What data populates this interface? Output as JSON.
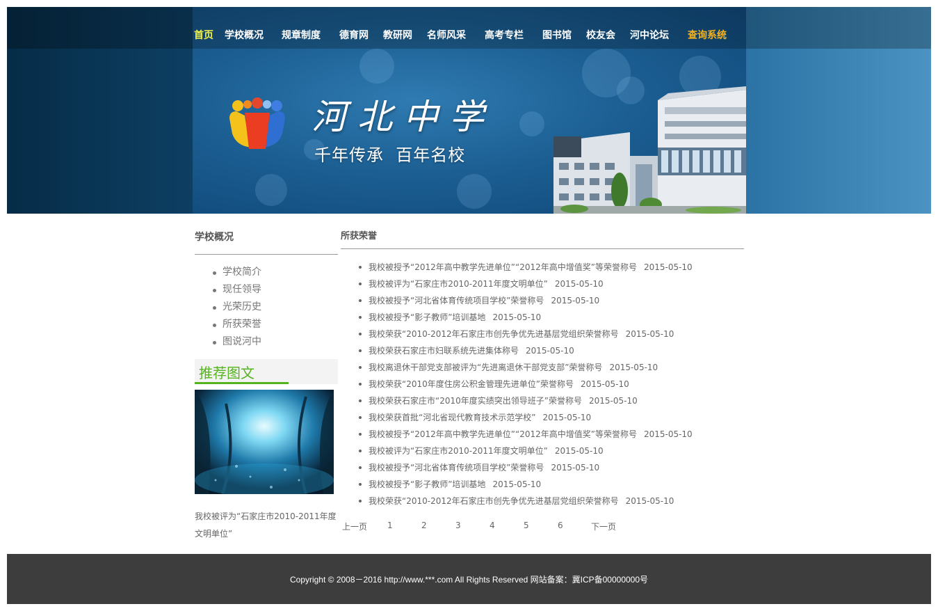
{
  "nav": {
    "items": [
      "首页",
      "学校概况",
      "规章制度",
      "德育网",
      "教研网",
      "名师风采",
      "高考专栏",
      "图书馆",
      "校友会",
      "河中论坛",
      "查询系统"
    ]
  },
  "banner": {
    "school_name": "河北中学",
    "slogan": "千年传承  百年名校"
  },
  "sidebar": {
    "title": "学校概况",
    "items": [
      "学校简介",
      "现任领导",
      "光荣历史",
      "所获荣誉",
      "图说河中"
    ],
    "recommend_title": "推荐图文",
    "recommend_caption": "我校被评为“石家庄市2010-2011年度文明单位”"
  },
  "main": {
    "title": "所获荣誉",
    "news": [
      {
        "title": "我校被授予“2012年高中教学先进单位”“2012年高中增值奖”等荣誉称号",
        "date": "2015-05-10"
      },
      {
        "title": "我校被评为“石家庄市2010-2011年度文明单位”",
        "date": "2015-05-10"
      },
      {
        "title": "我校被授予“河北省体育传统项目学校”荣誉称号",
        "date": "2015-05-10"
      },
      {
        "title": "我校被授予“影子教师”培训基地",
        "date": "2015-05-10"
      },
      {
        "title": "我校荣获“2010-2012年石家庄市创先争优先进基层党组织荣誉称号",
        "date": "2015-05-10"
      },
      {
        "title": "我校荣获石家庄市妇联系统先进集体称号",
        "date": "2015-05-10"
      },
      {
        "title": "我校离退休干部党支部被评为“先进离退休干部党支部”荣誉称号",
        "date": "2015-05-10"
      },
      {
        "title": "我校荣获“2010年度住房公积金管理先进单位”荣誉称号",
        "date": "2015-05-10"
      },
      {
        "title": "我校荣获石家庄市“2010年度实绩突出领导班子”荣誉称号",
        "date": "2015-05-10"
      },
      {
        "title": "我校荣获首批“河北省现代教育技术示范学校”",
        "date": "2015-05-10"
      },
      {
        "title": "我校被授予“2012年高中教学先进单位”“2012年高中增值奖”等荣誉称号",
        "date": "2015-05-10"
      },
      {
        "title": "我校被评为“石家庄市2010-2011年度文明单位”",
        "date": "2015-05-10"
      },
      {
        "title": "我校被授予“河北省体育传统项目学校”荣誉称号",
        "date": "2015-05-10"
      },
      {
        "title": "我校被授予“影子教师”培训基地",
        "date": "2015-05-10"
      },
      {
        "title": "我校荣获“2010-2012年石家庄市创先争优先进基层党组织荣誉称号",
        "date": "2015-05-10"
      }
    ],
    "pager": {
      "prev": "上一页",
      "pages": [
        "1",
        "2",
        "3",
        "4",
        "5",
        "6"
      ],
      "next": "下一页"
    }
  },
  "footer": {
    "text": "Copyright © 2008－2016 http://www.***.com All Rights Reserved 网站备案：冀ICP备00000000号"
  }
}
